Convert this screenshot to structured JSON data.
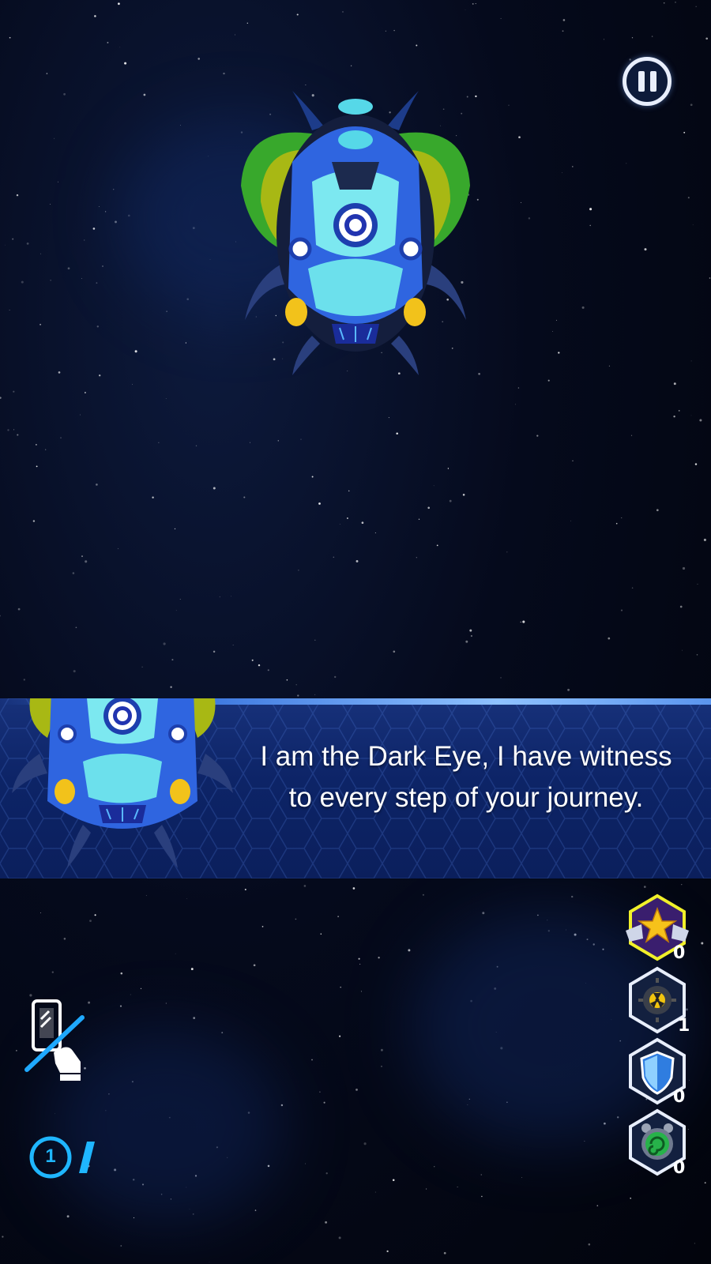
{
  "hud": {
    "pause_icon": "pause-icon",
    "lives_count": "1"
  },
  "dialog": {
    "line1": "I am the Dark Eye, I have witness",
    "line2": "to every step of your journey."
  },
  "powerups": [
    {
      "name": "rank-star",
      "count": "0"
    },
    {
      "name": "nuke-mine",
      "count": "1"
    },
    {
      "name": "shield",
      "count": "0"
    },
    {
      "name": "time-slow",
      "count": "0"
    }
  ],
  "colors": {
    "accent": "#3fb2ff",
    "banner": "#0d2467"
  }
}
